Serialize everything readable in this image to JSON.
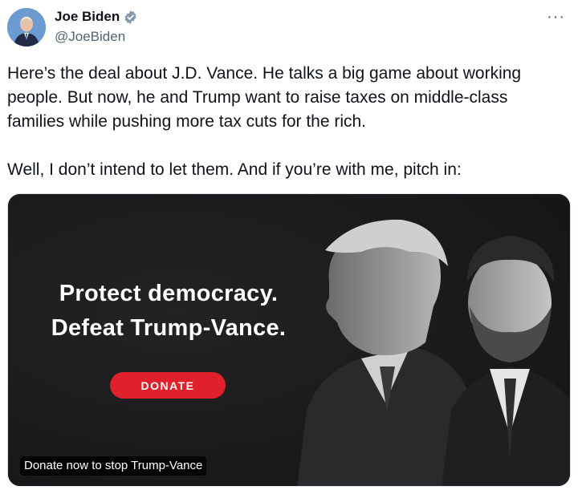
{
  "author": {
    "name": "Joe Biden",
    "handle": "@JoeBiden",
    "verified_icon": "verified-badge-icon",
    "avatar": "avatar-photo"
  },
  "more_icon": "more-options-icon",
  "more_glyph": "···",
  "tweet": {
    "paragraph1": "Here’s the deal about J.D. Vance. He talks a big game about working people. But now, he and Trump want to raise taxes on middle-class families while pushing more tax cuts for the rich.",
    "paragraph2": "Well, I don’t intend to let them. And if you’re with me, pitch in:"
  },
  "media": {
    "headline_line1": "Protect democracy.",
    "headline_line2": "Defeat Trump-Vance.",
    "donate_label": "DONATE",
    "caption": "Donate now to stop Trump-Vance",
    "background_color": "#1a1a1c",
    "button_color": "#e0202b"
  }
}
